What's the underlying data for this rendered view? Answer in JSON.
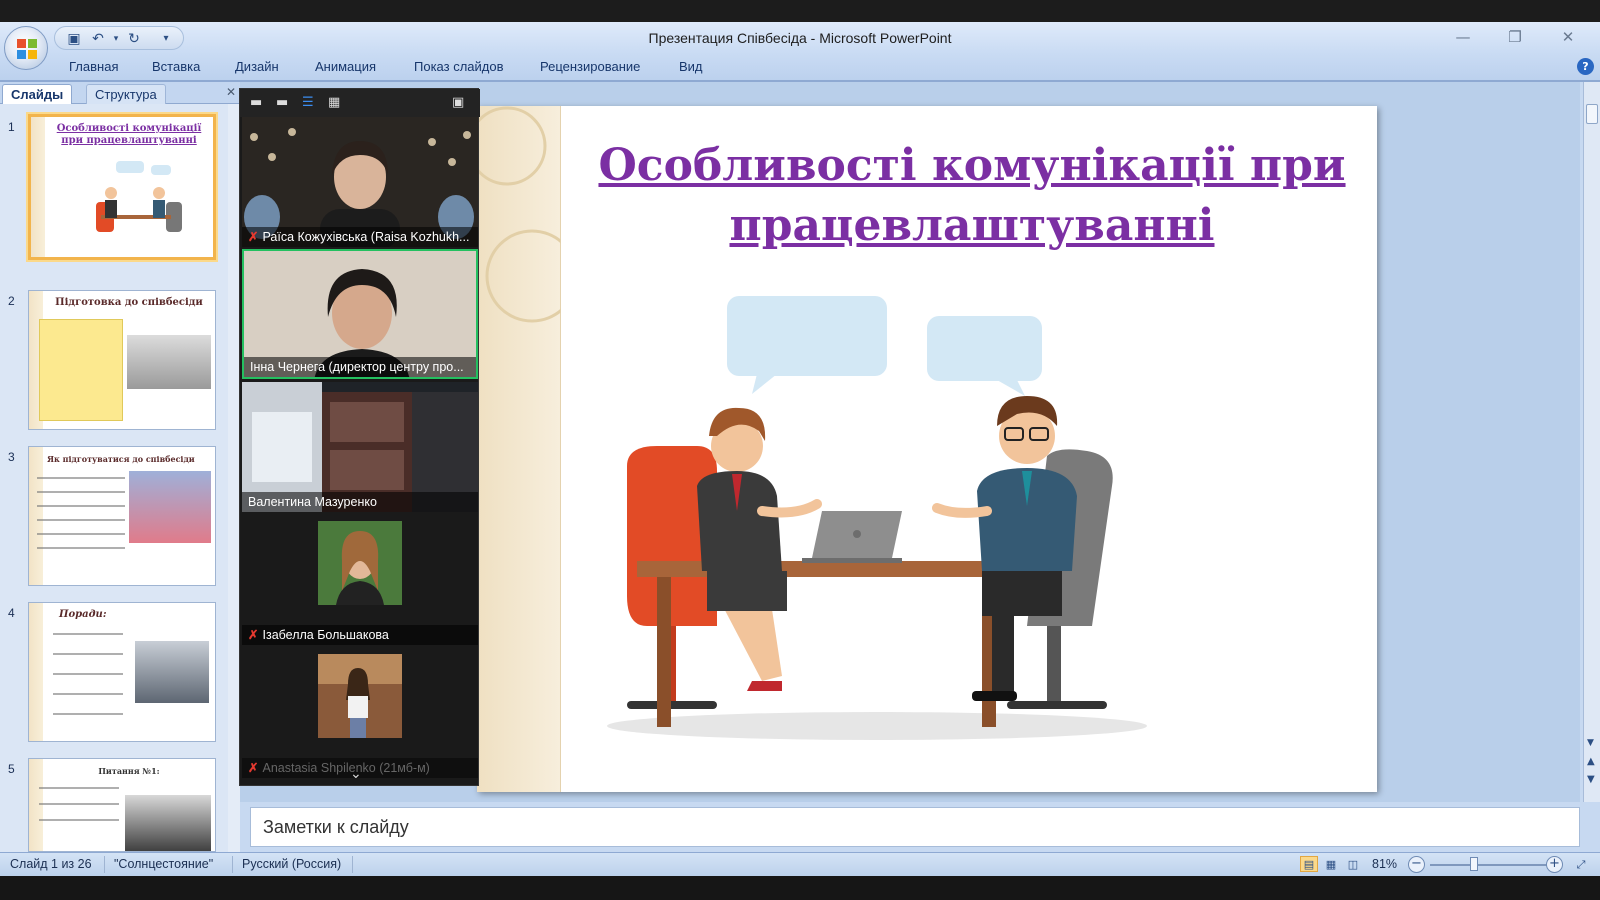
{
  "window": {
    "title": "Презентация Співбесіда - Microsoft PowerPoint"
  },
  "ribbon": {
    "tabs": [
      "Главная",
      "Вставка",
      "Дизайн",
      "Анимация",
      "Показ слайдов",
      "Рецензирование",
      "Вид"
    ]
  },
  "left_pane": {
    "tabs": [
      "Слайды",
      "Структура"
    ],
    "thumbnails": [
      {
        "number": "1",
        "title": "Особливості комунікації при працевлаштуванні"
      },
      {
        "number": "2",
        "title": "Підготовка до співбесіди"
      },
      {
        "number": "3",
        "title": "Як підготуватися до співбесіди"
      },
      {
        "number": "4",
        "title": "Поради:"
      },
      {
        "number": "5",
        "title": "Питання №1:"
      }
    ]
  },
  "video_panel": {
    "participants": [
      {
        "name": "Раїса Кожухівська (Raisa Kozhukh...",
        "muted": true
      },
      {
        "name": "Інна Чернега (директор центру про...",
        "muted": false,
        "speaking": true
      },
      {
        "name": "Валентина Мазуренко",
        "muted": false
      },
      {
        "name": "Ізабелла Большакова",
        "muted": true
      },
      {
        "name": "Anastasia Shpilenko (21мб-м)",
        "muted": true
      }
    ]
  },
  "slide": {
    "title": "Особливості комунікації при працевлаштуванні"
  },
  "notes": {
    "placeholder": "Заметки к слайду"
  },
  "status": {
    "slide_info": "Слайд 1 из 26",
    "theme": "\"Солнцестояние\"",
    "language": "Русский (Россия)",
    "zoom": "81%"
  }
}
